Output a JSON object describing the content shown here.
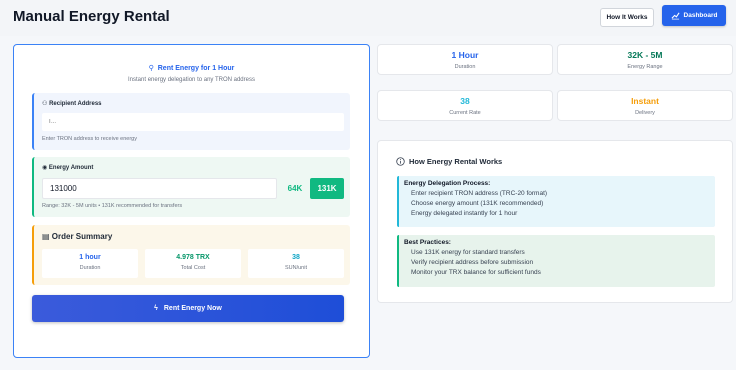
{
  "header": {
    "title": "Manual Energy Rental",
    "how_it_works_label": "How It Works",
    "dashboard_label": "Dashboard"
  },
  "rental_form": {
    "title": "Rent Energy for 1 Hour",
    "subtitle": "Instant energy delegation to any TRON address",
    "recipient": {
      "label": "Recipient Address",
      "placeholder": "T...",
      "help": "Enter TRON address to receive energy"
    },
    "energy": {
      "label": "Energy Amount",
      "value": "131000",
      "preset_64k": "64K",
      "preset_131k": "131K",
      "help": "Range: 32K - 5M units • 131K recommended for transfers"
    },
    "order_summary": {
      "label": "Order Summary",
      "stats": [
        {
          "value": "1 hour",
          "label": "Duration",
          "color": "#2563eb"
        },
        {
          "value": "4.978 TRX",
          "label": "Total Cost",
          "color": "#059669"
        },
        {
          "value": "38",
          "label": "SUN/unit",
          "color": "#0ea5c6"
        }
      ]
    },
    "submit_label": "Rent Energy Now"
  },
  "stats": [
    {
      "value": "1 Hour",
      "label": "Duration",
      "color": "#2563eb"
    },
    {
      "value": "32K - 5M",
      "label": "Energy Range",
      "color": "#047857"
    },
    {
      "value": "38",
      "label": "Current Rate",
      "color": "#22b8d8"
    },
    {
      "value": "Instant",
      "label": "Delivery",
      "color": "#f59e0b"
    }
  ],
  "how_it_works": {
    "title": "How Energy Rental Works",
    "delegation": {
      "title": "Energy Delegation Process:",
      "lines": [
        "Enter recipient TRON address (TRC-20 format)",
        "Choose energy amount (131K recommended)",
        "Energy delegated instantly for 1 hour"
      ]
    },
    "best_practices": {
      "title": "Best Practices:",
      "lines": [
        "Use 131K energy for standard transfers",
        "Verify recipient address before submission",
        "Monitor your TRX balance for sufficient funds"
      ]
    }
  }
}
